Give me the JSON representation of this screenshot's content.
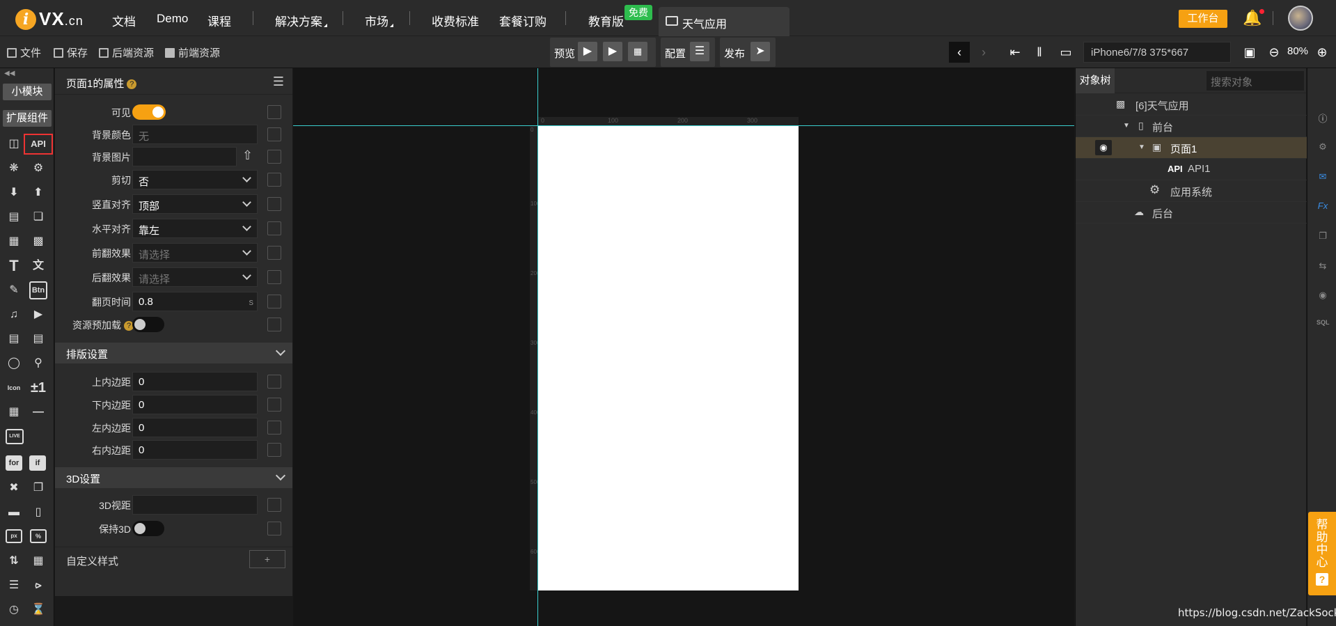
{
  "brand": {
    "logo_letter": "i",
    "name": "VX",
    "suffix": ".cn"
  },
  "nav": {
    "items": [
      "文档",
      "Demo",
      "课程",
      "解决方案",
      "市场",
      "收费标准",
      "套餐订购",
      "教育版"
    ],
    "free_badge": "免费",
    "app_tab": "天气应用",
    "workbench": "工作台"
  },
  "toolbar": {
    "file": "文件",
    "save": "保存",
    "backend": "后端资源",
    "frontend": "前端资源",
    "preview": "预览",
    "config": "配置",
    "publish": "发布",
    "device": "iPhone6/7/8 375*667",
    "zoom": "80%"
  },
  "leftbar": {
    "modules": "小模块",
    "extensions": "扩展组件",
    "api": "API",
    "tools": [
      "T",
      "Btn",
      "Icon",
      "±1",
      "for",
      "if",
      "px",
      "%"
    ]
  },
  "props": {
    "title": "页面1的属性",
    "help": "?",
    "visible_label": "可见",
    "bgcolor_label": "背景颜色",
    "bgcolor_value": "无",
    "bgimage_label": "背景图片",
    "clip_label": "剪切",
    "clip_value": "否",
    "valign_label": "竖直对齐",
    "valign_value": "顶部",
    "halign_label": "水平对齐",
    "halign_value": "靠左",
    "front_label": "前翻效果",
    "front_value": "请选择",
    "back_label": "后翻效果",
    "back_value": "请选择",
    "flip_label": "翻页时间",
    "flip_value": "0.8",
    "flip_unit": "s",
    "preload_label": "资源预加载",
    "layout_section": "排版设置",
    "pt_label": "上内边距",
    "pt_value": "0",
    "pb_label": "下内边距",
    "pb_value": "0",
    "pl_label": "左内边距",
    "pl_value": "0",
    "pr_label": "右内边距",
    "pr_value": "0",
    "section3d": "3D设置",
    "view3d_label": "3D视距",
    "keep3d_label": "保持3D",
    "custom_label": "自定义样式",
    "add": "+"
  },
  "ruler": {
    "top": [
      "0",
      "100",
      "200",
      "300"
    ],
    "left": [
      "0",
      "100",
      "200",
      "300",
      "400",
      "500",
      "600"
    ]
  },
  "tree": {
    "tab": "对象树",
    "search_placeholder": "搜索对象",
    "items": [
      "[6]天气应用",
      "前台",
      "页面1",
      "API1",
      "应用系统",
      "后台"
    ],
    "api_tag": "API"
  },
  "help": {
    "label": "帮助中心",
    "icon": "?"
  },
  "watermark": "https://blog.csdn.net/ZackSock"
}
